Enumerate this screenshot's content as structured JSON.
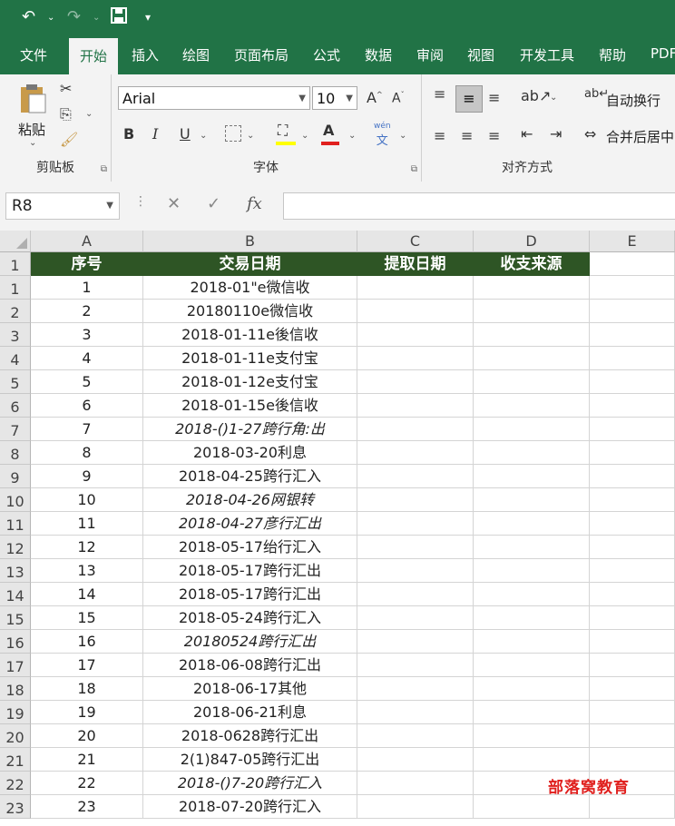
{
  "qat": {
    "undo_icon": "undo-icon",
    "redo_icon": "redo-icon",
    "save_icon": "save-icon"
  },
  "tabs": [
    "文件",
    "开始",
    "插入",
    "绘图",
    "页面布局",
    "公式",
    "数据",
    "审阅",
    "视图",
    "开发工具",
    "帮助",
    "PDF"
  ],
  "active_tab": "开始",
  "ribbon": {
    "clipboard": {
      "paste": "粘贴",
      "group": "剪贴板"
    },
    "font": {
      "name": "Arial",
      "size": "10",
      "grow": "A",
      "shrink": "A",
      "bold": "B",
      "italic": "I",
      "underline": "U",
      "font_color": "A",
      "phonetic_top": "wén",
      "phonetic_bottom": "文",
      "group": "字体"
    },
    "alignment": {
      "wrap": "自动换行",
      "merge": "合并后居中",
      "group": "对齐方式"
    }
  },
  "formula_bar": {
    "name_box": "R8",
    "cancel": "✕",
    "enter": "✓",
    "fx": "fx",
    "value": ""
  },
  "columns": [
    "A",
    "B",
    "C",
    "D",
    "E"
  ],
  "header_row": [
    "序号",
    "交易日期",
    "提取日期",
    "收支来源"
  ],
  "rows": [
    {
      "n": "1",
      "a": "1",
      "b": "2018-01\"e微信收",
      "italic": false
    },
    {
      "n": "2",
      "a": "2",
      "b": "20180110e微信收",
      "italic": false
    },
    {
      "n": "3",
      "a": "3",
      "b": "2018-01-11e後信收",
      "italic": false
    },
    {
      "n": "4",
      "a": "4",
      "b": "2018-01-11e支付宝",
      "italic": false
    },
    {
      "n": "5",
      "a": "5",
      "b": "2018-01-12e支付宝",
      "italic": false
    },
    {
      "n": "6",
      "a": "6",
      "b": "2018-01-15e後信收",
      "italic": false
    },
    {
      "n": "7",
      "a": "7",
      "b": "2018-()1-27跨行角:出",
      "italic": true
    },
    {
      "n": "8",
      "a": "8",
      "b": "2018-03-20利息",
      "italic": false
    },
    {
      "n": "9",
      "a": "9",
      "b": "2018-04-25跨行汇入",
      "italic": false
    },
    {
      "n": "10",
      "a": "10",
      "b": "2018-04-26网银转",
      "italic": true
    },
    {
      "n": "11",
      "a": "11",
      "b": "2018-04-27彦行汇出",
      "italic": true
    },
    {
      "n": "12",
      "a": "12",
      "b": "2018-05-17绐行汇入",
      "italic": false
    },
    {
      "n": "13",
      "a": "13",
      "b": "2018-05-17跨行汇出",
      "italic": false
    },
    {
      "n": "14",
      "a": "14",
      "b": "2018-05-17跨行汇出",
      "italic": false
    },
    {
      "n": "15",
      "a": "15",
      "b": "2018-05-24跨行汇入",
      "italic": false
    },
    {
      "n": "16",
      "a": "16",
      "b": "20180524跨行汇出",
      "italic": true
    },
    {
      "n": "17",
      "a": "17",
      "b": "2018-06-08跨行汇出",
      "italic": false
    },
    {
      "n": "18",
      "a": "18",
      "b": "2018-06-17其他",
      "italic": false
    },
    {
      "n": "19",
      "a": "19",
      "b": "2018-06-21利息",
      "italic": false
    },
    {
      "n": "20",
      "a": "20",
      "b": "2018-0628跨行汇出",
      "italic": false
    },
    {
      "n": "21",
      "a": "21",
      "b": "2(1)847-05跨行汇出",
      "italic": false
    },
    {
      "n": "22",
      "a": "22",
      "b": "2018-()7-20跨行汇入",
      "italic": true
    },
    {
      "n": "23",
      "a": "23",
      "b": "2018-07-20跨行汇入",
      "italic": false
    }
  ],
  "watermark": "部落窝教育",
  "colors": {
    "excel_green": "#217346",
    "header_fill": "#2e5525",
    "watermark": "#e0201e"
  }
}
